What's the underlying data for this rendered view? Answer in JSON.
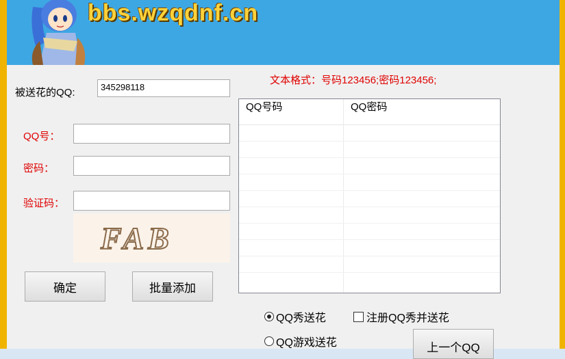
{
  "banner": {
    "site_text": "bbs.wzqdnf.cn"
  },
  "hint": "文本格式：号码123456;密码123456;",
  "form": {
    "recipient_label": "被送花的QQ:",
    "recipient_value": "345298118",
    "qq_label": "QQ号：",
    "qq_value": "",
    "password_label": "密码：",
    "password_value": "",
    "captcha_label": "验证码：",
    "captcha_value": "",
    "captcha_text": "FAB"
  },
  "buttons": {
    "confirm": "确定",
    "batch_add": "批量添加",
    "next_qq": "上一个QQ"
  },
  "table": {
    "columns": [
      "QQ号码",
      "QQ密码"
    ],
    "rows": []
  },
  "options": {
    "show_flower": {
      "label": "QQ秀送花",
      "checked": true
    },
    "game_flower": {
      "label": "QQ游戏送花",
      "checked": false
    },
    "register_and_flower": {
      "label": "注册QQ秀并送花",
      "checked": false
    }
  },
  "colors": {
    "banner": "#3da7e3",
    "accent_red": "#e00000",
    "frame": "#f0b400"
  }
}
